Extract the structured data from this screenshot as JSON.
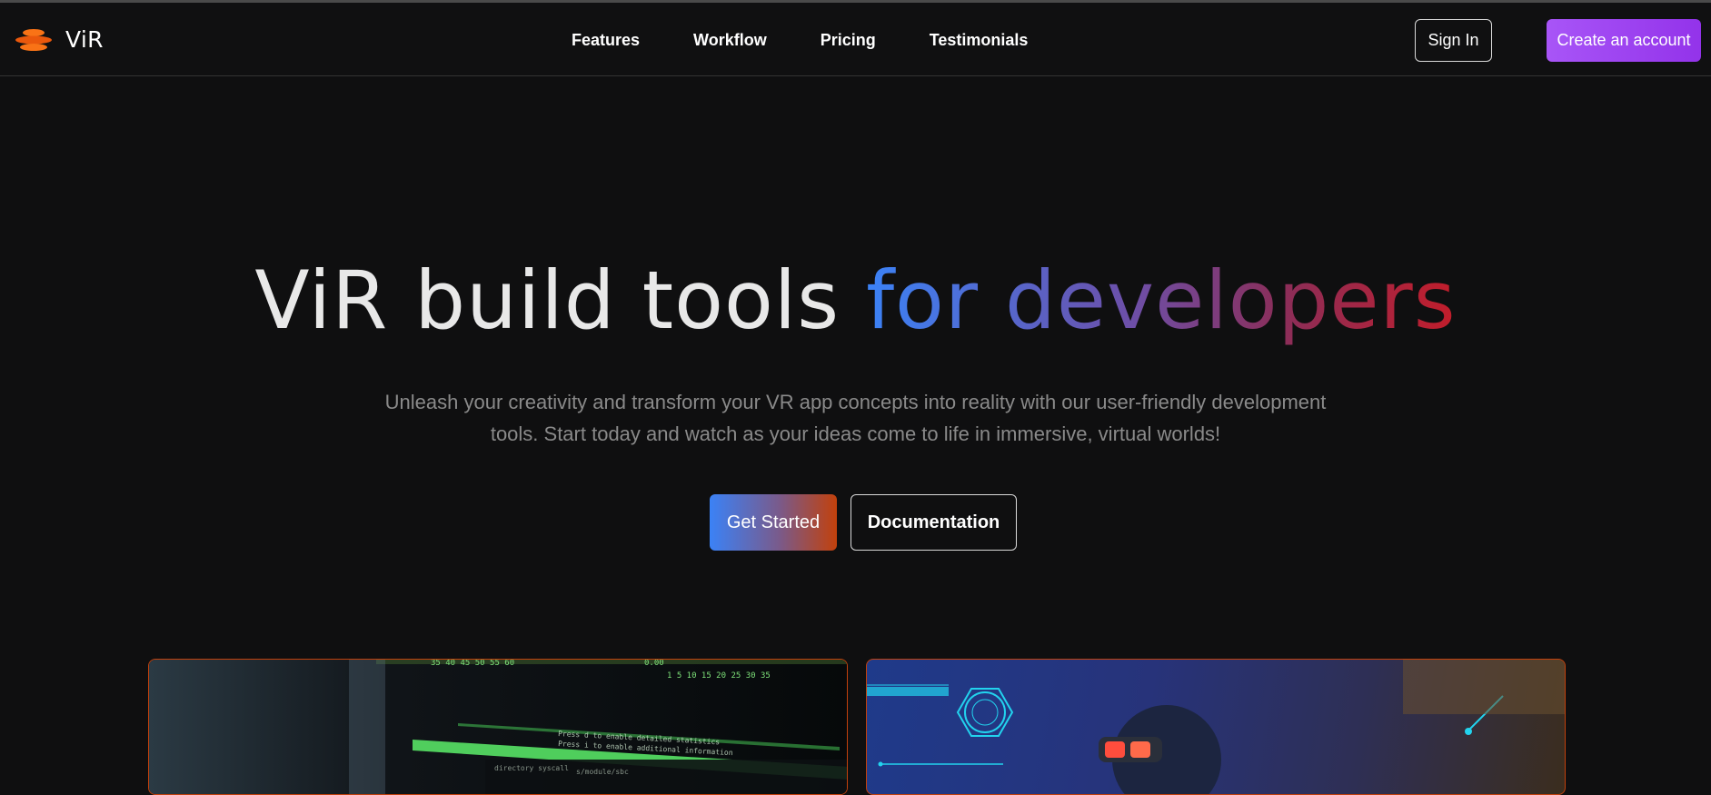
{
  "brand": {
    "name": "ViR",
    "logo_icon": "layered-discs-logo",
    "accent": "#f97316"
  },
  "nav": {
    "links": [
      "Features",
      "Workflow",
      "Pricing",
      "Testimonials"
    ],
    "signin_label": "Sign In",
    "create_label": "Create an account",
    "create_color": "#a855f7"
  },
  "hero": {
    "title_plain": "ViR build tools ",
    "title_gradient": "for developers",
    "subtitle": "Unleash your creativity and transform your VR app concepts into reality with our user-friendly development tools. Start today and watch as your ideas come to life in immersive, virtual worlds!",
    "primary_label": "Get Started",
    "secondary_label": "Documentation"
  },
  "cards": [
    {
      "image": "terminal-screen-photo"
    },
    {
      "image": "vr-headset-hud-photo"
    }
  ]
}
